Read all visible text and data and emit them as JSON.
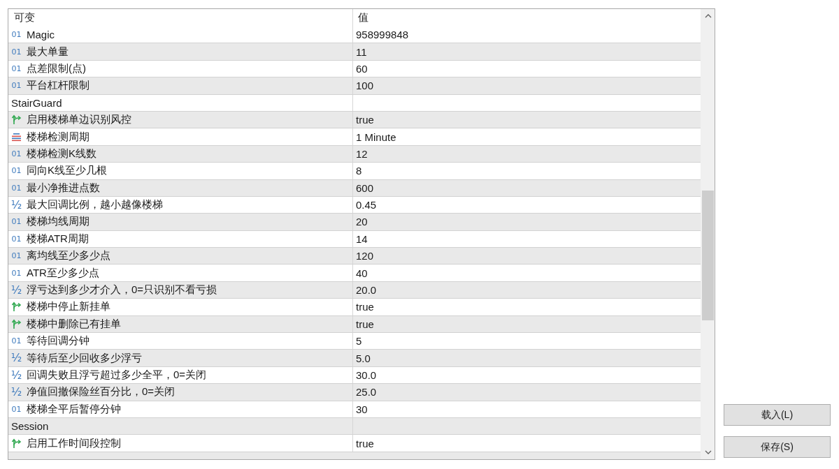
{
  "table": {
    "columns": [
      "可变",
      "值"
    ],
    "rows": [
      {
        "kind": "int",
        "icon": "01",
        "name": "Magic",
        "value": "958999848"
      },
      {
        "kind": "int",
        "icon": "01",
        "name": "最大单量",
        "value": "11"
      },
      {
        "kind": "int",
        "icon": "01",
        "name": "点差限制(点)",
        "value": "60"
      },
      {
        "kind": "int",
        "icon": "01",
        "name": "平台杠杆限制",
        "value": "100"
      },
      {
        "kind": "group",
        "name": "StairGuard"
      },
      {
        "kind": "bool",
        "name": "启用楼梯单边识别风控",
        "value": "true"
      },
      {
        "kind": "enum",
        "name": "楼梯检测周期",
        "value": "1 Minute"
      },
      {
        "kind": "int",
        "icon": "01",
        "name": "楼梯检测K线数",
        "value": "12"
      },
      {
        "kind": "int",
        "icon": "01",
        "name": "同向K线至少几根",
        "value": "8"
      },
      {
        "kind": "int",
        "icon": "01",
        "name": "最小净推进点数",
        "value": "600"
      },
      {
        "kind": "double",
        "icon": "½",
        "name": "最大回调比例，越小越像楼梯",
        "value": "0.45"
      },
      {
        "kind": "int",
        "icon": "01",
        "name": "楼梯均线周期",
        "value": "20"
      },
      {
        "kind": "int",
        "icon": "01",
        "name": "楼梯ATR周期",
        "value": "14"
      },
      {
        "kind": "int",
        "icon": "01",
        "name": "离均线至少多少点",
        "value": "120"
      },
      {
        "kind": "int",
        "icon": "01",
        "name": "ATR至少多少点",
        "value": "40"
      },
      {
        "kind": "double",
        "icon": "½",
        "name": "浮亏达到多少才介入，0=只识别不看亏损",
        "value": "20.0"
      },
      {
        "kind": "bool",
        "name": "楼梯中停止新挂单",
        "value": "true"
      },
      {
        "kind": "bool",
        "name": "楼梯中删除已有挂单",
        "value": "true"
      },
      {
        "kind": "int",
        "icon": "01",
        "name": "等待回调分钟",
        "value": "5"
      },
      {
        "kind": "double",
        "icon": "½",
        "name": "等待后至少回收多少浮亏",
        "value": "5.0"
      },
      {
        "kind": "double",
        "icon": "½",
        "name": "回调失败且浮亏超过多少全平，0=关闭",
        "value": "30.0"
      },
      {
        "kind": "double",
        "icon": "½",
        "name": "净值回撤保险丝百分比，0=关闭",
        "value": "25.0"
      },
      {
        "kind": "int",
        "icon": "01",
        "name": "楼梯全平后暂停分钟",
        "value": "30"
      },
      {
        "kind": "group",
        "name": "Session"
      },
      {
        "kind": "bool",
        "name": "启用工作时间段控制",
        "value": "true"
      }
    ]
  },
  "buttons": [
    "载入(L)",
    "保存(S)"
  ]
}
